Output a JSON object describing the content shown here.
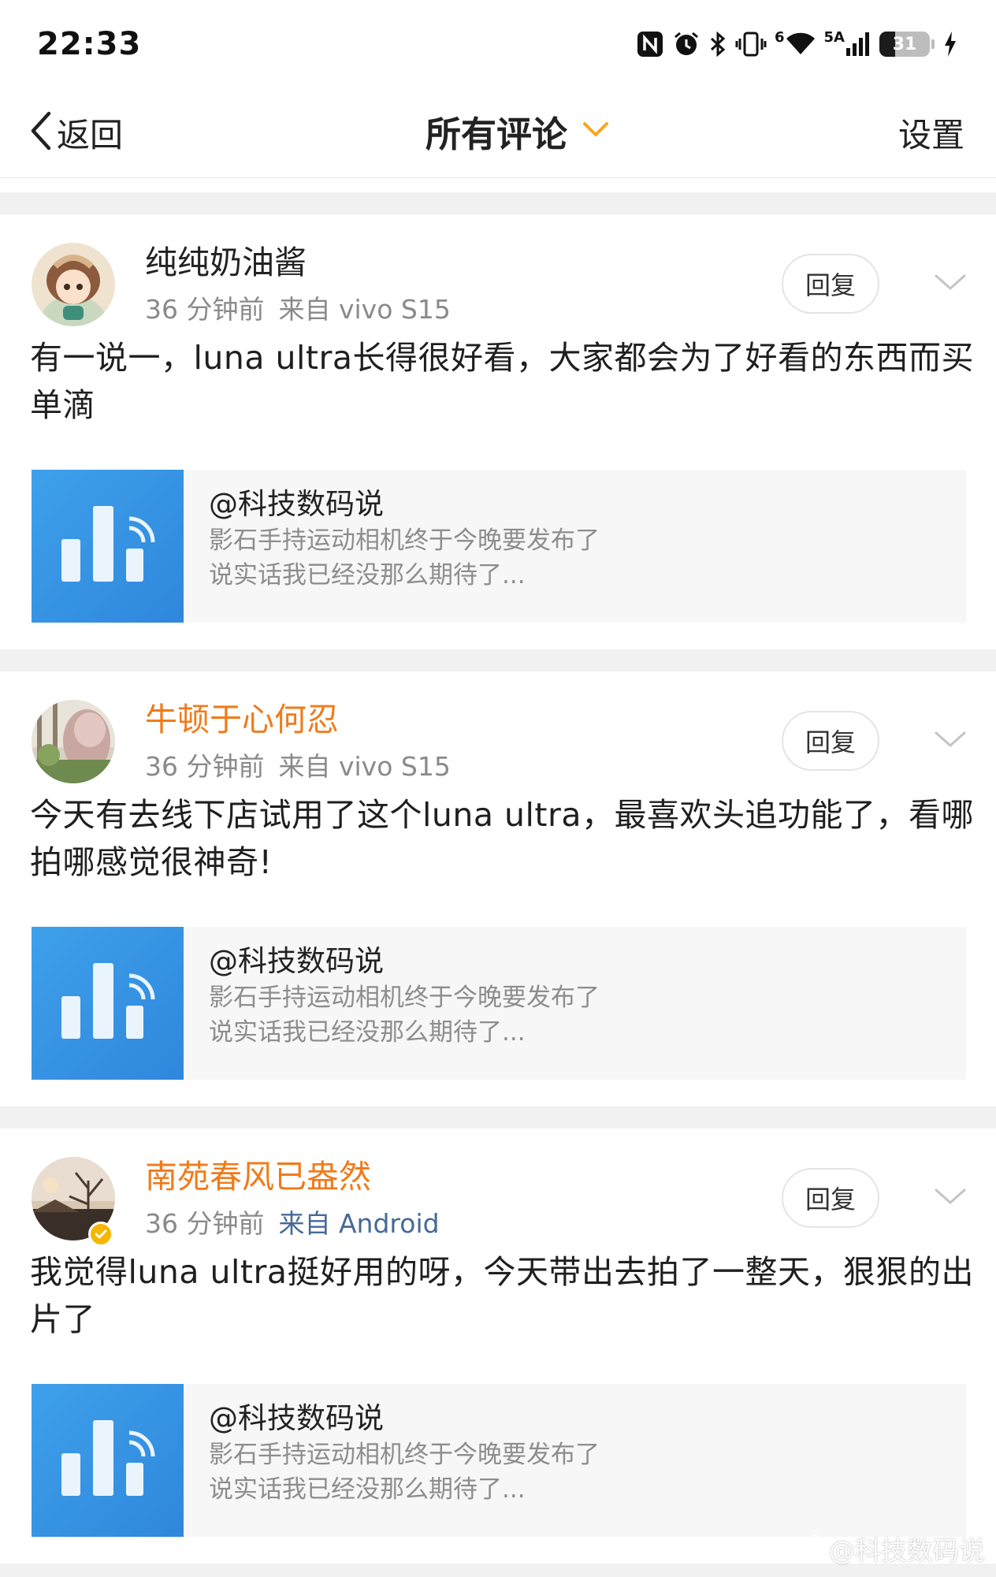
{
  "status_bar": {
    "time": "22:33",
    "network_label_a": "6",
    "network_label_b": "5A",
    "battery_level": 31,
    "battery_text": "31",
    "icons": [
      "nfc-icon",
      "alarm-icon",
      "bluetooth-icon",
      "vibrate-icon",
      "wifi-icon",
      "signal-icon",
      "battery-icon",
      "charging-icon"
    ]
  },
  "nav": {
    "back_label": "返回",
    "title": "所有评论",
    "settings_label": "设置",
    "accent_color": "#f5a623"
  },
  "comments": [
    {
      "username": "纯纯奶油酱",
      "username_color": "#222222",
      "time": "36 分钟前",
      "device": "来自 vivo S15",
      "reply_label": "回复",
      "text": "有一说一，luna ultra长得很好看，大家都会为了好看的东西而买单滴",
      "quote": {
        "author": "@科技数码说",
        "line1": "影石手持运动相机终于今晚要发布了",
        "line2": "说实话我已经没那么期待了..."
      }
    },
    {
      "username": "牛顿于心何忍",
      "username_color": "#f07b1a",
      "time": "36 分钟前",
      "device": "来自 vivo S15",
      "reply_label": "回复",
      "text": "今天有去线下店试用了这个luna ultra，最喜欢头追功能了，看哪拍哪感觉很神奇!",
      "quote": {
        "author": "@科技数码说",
        "line1": "影石手持运动相机终于今晚要发布了",
        "line2": "说实话我已经没那么期待了..."
      }
    },
    {
      "username": "南苑春风已盎然",
      "username_color": "#f07b1a",
      "time": "36 分钟前",
      "device": "来自 Android",
      "reply_label": "回复",
      "text": "我觉得luna ultra挺好用的呀，今天带出去拍了一整天，狠狠的出片了",
      "quote": {
        "author": "@科技数码说",
        "line1": "影石手持运动相机终于今晚要发布了",
        "line2": "说实话我已经没那么期待了..."
      }
    }
  ],
  "watermark": "@科技数码说"
}
